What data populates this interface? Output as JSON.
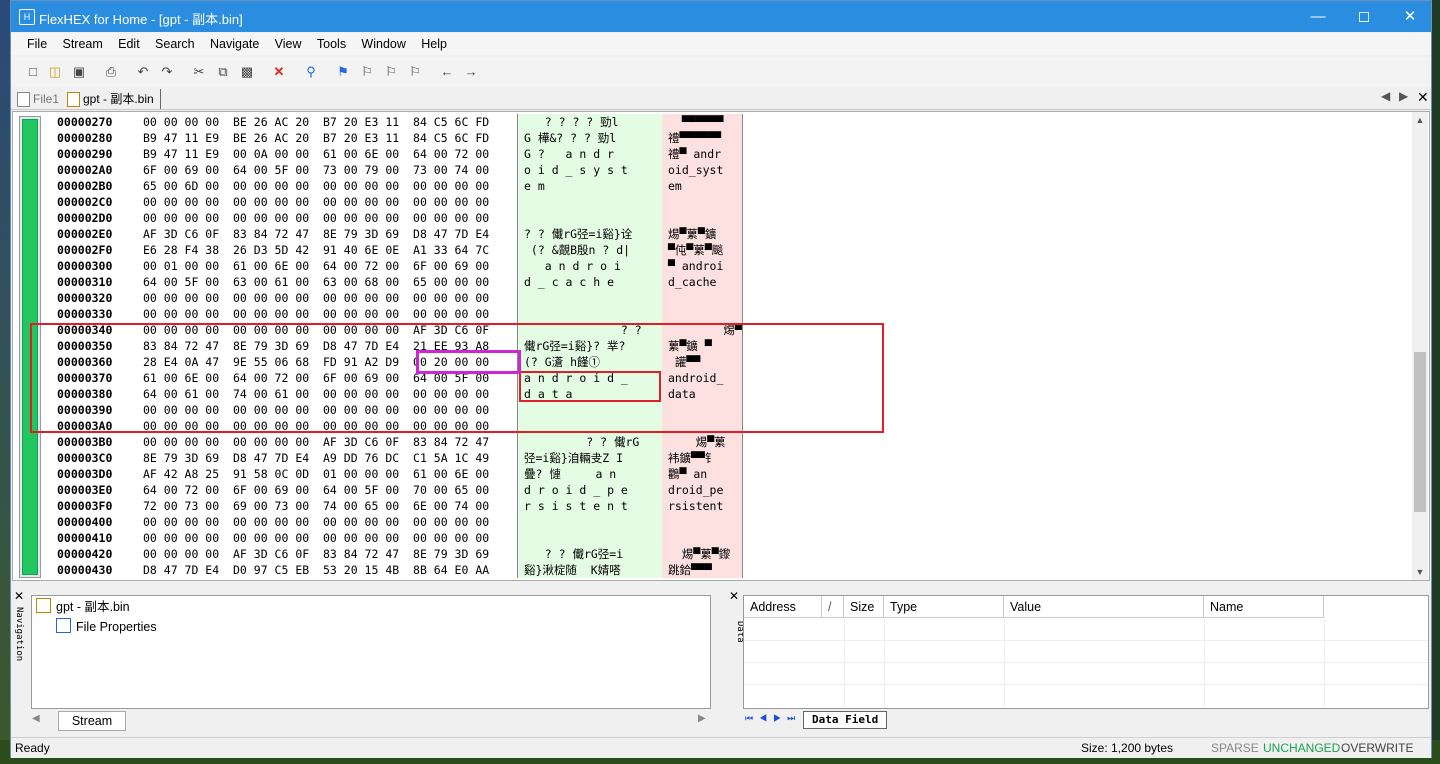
{
  "window": {
    "title": "FlexHEX for Home - [gpt - 副本.bin]",
    "app_icon": "hex-app-icon"
  },
  "menu": [
    "File",
    "Stream",
    "Edit",
    "Search",
    "Navigate",
    "View",
    "Tools",
    "Window",
    "Help"
  ],
  "tabs": [
    {
      "label": "File1"
    },
    {
      "label": "gpt - 副本.bin"
    }
  ],
  "hex": {
    "addresses": [
      "00000270",
      "00000280",
      "00000290",
      "000002A0",
      "000002B0",
      "000002C0",
      "000002D0",
      "000002E0",
      "000002F0",
      "00000300",
      "00000310",
      "00000320",
      "00000330",
      "00000340",
      "00000350",
      "00000360",
      "00000370",
      "00000380",
      "00000390",
      "000003A0",
      "000003B0",
      "000003C0",
      "000003D0",
      "000003E0",
      "000003F0",
      "00000400",
      "00000410",
      "00000420",
      "00000430"
    ],
    "bytes": [
      "00 00 00 00  BE 26 AC 20  B7 20 E3 11  84 C5 6C FD",
      "B9 47 11 E9  BE 26 AC 20  B7 20 E3 11  84 C5 6C FD",
      "B9 47 11 E9  00 0A 00 00  61 00 6E 00  64 00 72 00",
      "6F 00 69 00  64 00 5F 00  73 00 79 00  73 00 74 00",
      "65 00 6D 00  00 00 00 00  00 00 00 00  00 00 00 00",
      "00 00 00 00  00 00 00 00  00 00 00 00  00 00 00 00",
      "00 00 00 00  00 00 00 00  00 00 00 00  00 00 00 00",
      "AF 3D C6 0F  83 84 72 47  8E 79 3D 69  D8 47 7D E4",
      "E6 28 F4 38  26 D3 5D 42  91 40 6E 0E  A1 33 64 7C",
      "00 01 00 00  61 00 6E 00  64 00 72 00  6F 00 69 00",
      "64 00 5F 00  63 00 61 00  63 00 68 00  65 00 00 00",
      "00 00 00 00  00 00 00 00  00 00 00 00  00 00 00 00",
      "00 00 00 00  00 00 00 00  00 00 00 00  00 00 00 00",
      "00 00 00 00  00 00 00 00  00 00 00 00  AF 3D C6 0F",
      "83 84 72 47  8E 79 3D 69  D8 47 7D E4  21 EE 93 A8",
      "28 E4 0A 47  9E 55 06 68  FD 91 A2 D9  00 20 00 00",
      "61 00 6E 00  64 00 72 00  6F 00 69 00  64 00 5F 00",
      "64 00 61 00  74 00 61 00  00 00 00 00  00 00 00 00",
      "00 00 00 00  00 00 00 00  00 00 00 00  00 00 00 00",
      "00 00 00 00  00 00 00 00  00 00 00 00  00 00 00 00",
      "00 00 00 00  00 00 00 00  AF 3D C6 0F  83 84 72 47",
      "8E 79 3D 69  D8 47 7D E4  A9 DD 76 DC  C1 5A 1C 49",
      "AF 42 A8 25  91 58 0C 0D  01 00 00 00  61 00 6E 00",
      "64 00 72 00  6F 00 69 00  64 00 5F 00  70 00 65 00",
      "72 00 73 00  69 00 73 00  74 00 65 00  6E 00 74 00",
      "00 00 00 00  00 00 00 00  00 00 00 00  00 00 00 00",
      "00 00 00 00  00 00 00 00  00 00 00 00  00 00 00 00",
      "00 00 00 00  AF 3D C6 0F  83 84 72 47  8E 79 3D 69",
      "D8 47 7D E4  D0 97 C5 EB  53 20 15 4B  8B 64 E0 AA"
    ],
    "ansi": [
      "   ? ? ? ? 勁l",
      "G 樺&? ? ? 勁l",
      "G ?   a n d r",
      "o i d _ s y s t",
      "e m",
      "",
      "",
      "? ? 儎rG弪=i谿}诠",
      " (? &覿B殷n ? d|",
      "   a n d r o i",
      "d _ c a c h e",
      "",
      "",
      "              ? ?",
      "儎rG弪=i谿}? 丵?",
      "(? G濸 h饉①",
      "a n d r o i d _",
      "d a t a",
      "",
      "",
      "         ? ? 儎rG",
      "弪=i谿}洎輛叏Z I",
      "疊? 慩     a n",
      "d r o i d _ p e",
      "r s i s t e n t",
      "",
      "",
      "   ? ? 儎rG弪=i",
      "谿}湫椗随  K婧嗒"
    ],
    "unicode": [
      "  ▀▀▀▀▀▀",
      "禮▀▀▀▀▀▀",
      "禮▀ andr",
      "oid_syst",
      "em",
      "",
      "",
      "焬▀蔂▀鑛",
      "▀伅▀蔂▀颷",
      "▀ androi",
      "d_cache",
      "",
      "",
      "        焬▀",
      "蔂▀鑛 ▀",
      " 讙▀▀",
      "android_",
      "data",
      "",
      "",
      "    焬▀蔂",
      "袆鑛▀▀钅",
      "鸜▀ an",
      "droid_pe",
      "rsistent",
      "",
      "",
      "  焬▀蔂▀鑗",
      "跳鉿▀▀▀"
    ]
  },
  "navigation": {
    "label": "Navigation",
    "tree_root": "gpt - 副本.bin",
    "tree_child": "File Properties",
    "stream_tab": "Stream"
  },
  "data_panel": {
    "label": "Data",
    "columns": [
      "Address",
      "/",
      "Size",
      "Type",
      "Value",
      "Name"
    ],
    "tab": "Data Field"
  },
  "status": {
    "ready": "Ready",
    "size": "Size: 1,200 bytes",
    "sparse": "SPARSE",
    "unchanged": "UNCHANGED",
    "overwrite": "OVERWRITE"
  },
  "colors": {
    "titlebar": "#2b8de0",
    "ansi_bg": "#e4fbe4",
    "unicode_bg": "#fde0e0",
    "highlight_red": "#e11d2a",
    "highlight_magenta": "#d026d0",
    "unchanged": "#16a34a"
  }
}
